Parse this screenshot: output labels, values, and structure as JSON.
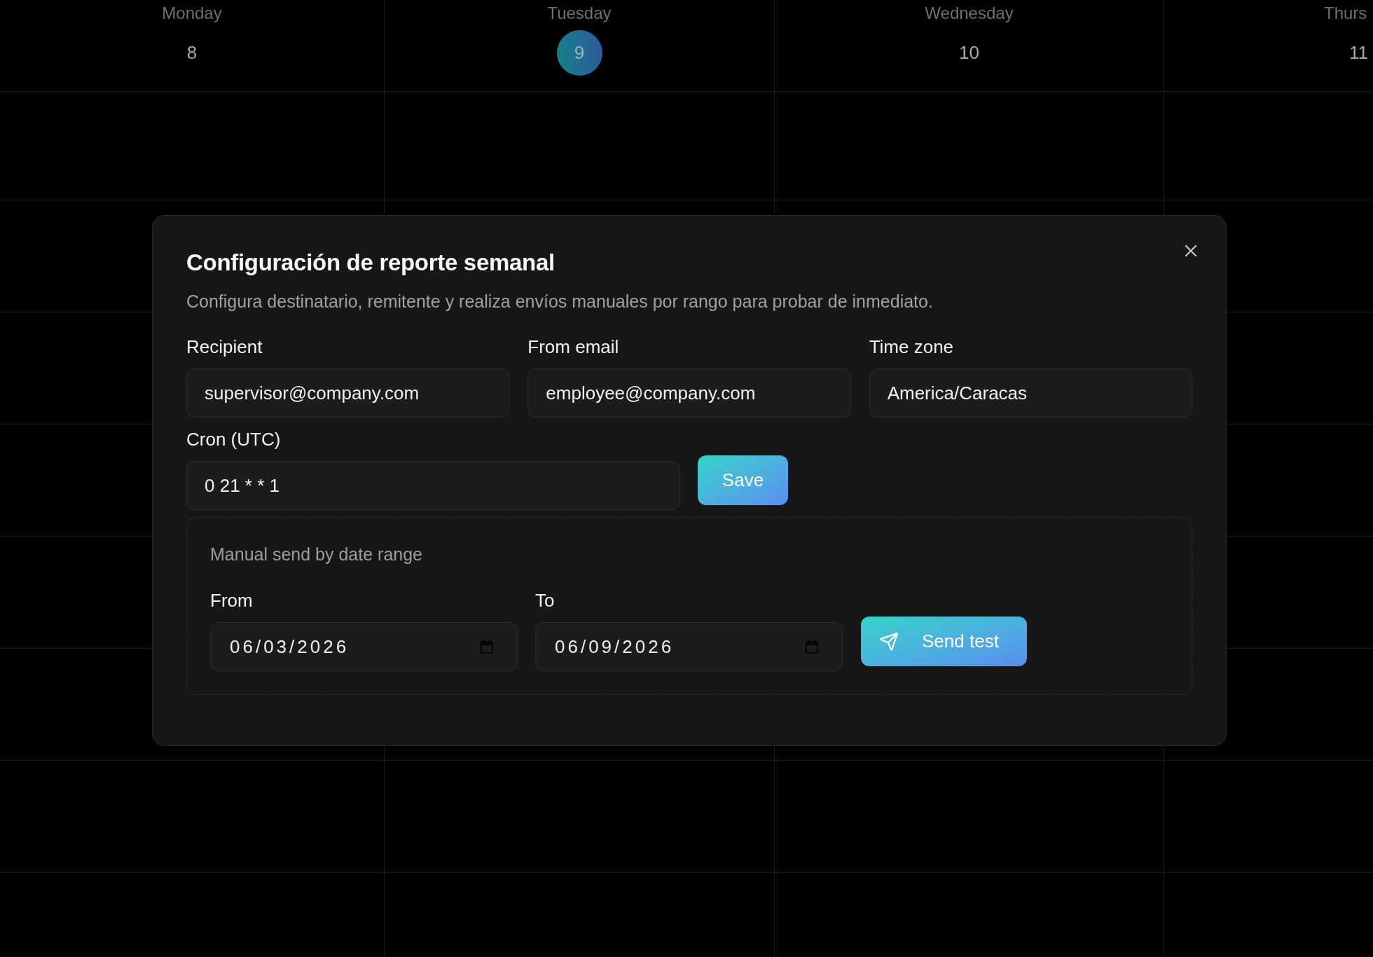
{
  "calendar": {
    "days": [
      {
        "name": "Monday",
        "date": "8",
        "today": false
      },
      {
        "name": "Tuesday",
        "date": "9",
        "today": true
      },
      {
        "name": "Wednesday",
        "date": "10",
        "today": false
      },
      {
        "name": "Thurs",
        "date": "11",
        "today": false
      }
    ]
  },
  "dialog": {
    "title": "Configuración de reporte semanal",
    "description": "Configura destinatario, remitente y realiza envíos manuales por rango para probar de inmediato.",
    "fields": [
      {
        "label": "Recipient",
        "value": "supervisor@company.com"
      },
      {
        "label": "From email",
        "value": "employee@company.com"
      },
      {
        "label": "Time zone",
        "value": "America/Caracas"
      }
    ],
    "cron": {
      "label": "Cron (UTC)",
      "value": "0 21 * * 1"
    },
    "save_button": "Save",
    "manual_send": {
      "title": "Manual send by date range",
      "from": {
        "label": "From",
        "value": "06/03/2026"
      },
      "to": {
        "label": "To",
        "value": "06/09/2026"
      },
      "send_button": "Send test"
    }
  }
}
